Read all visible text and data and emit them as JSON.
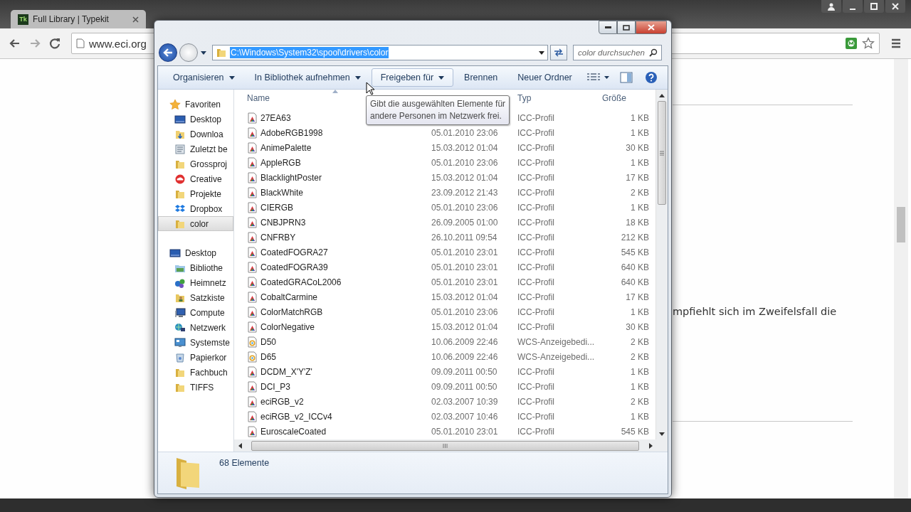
{
  "browser": {
    "tabs": [
      {
        "label": "Full Library | Typekit",
        "favicon": "Tk",
        "selected": false
      }
    ],
    "address": "www.eci.org",
    "page_text": "mpfiehlt sich im Zweifelsfall die"
  },
  "explorer": {
    "address": {
      "path": "C:\\Windows\\System32\\spool\\drivers\\color",
      "selected": true
    },
    "search": {
      "placeholder": "color durchsuchen"
    },
    "toolbar": [
      {
        "label": "Organisieren",
        "dropdown": true,
        "hover": false
      },
      {
        "label": "In Bibliothek aufnehmen",
        "dropdown": true,
        "hover": false
      },
      {
        "label": "Freigeben für",
        "dropdown": true,
        "hover": true
      },
      {
        "label": "Brennen",
        "dropdown": false,
        "hover": false
      },
      {
        "label": "Neuer Ordner",
        "dropdown": false,
        "hover": false
      }
    ],
    "tooltip": [
      "Gibt die ausgewählten Elemente für",
      "andere Personen im Netzwerk frei."
    ],
    "sidebar": [
      {
        "label": "Favoriten",
        "kind": "star",
        "selected": false,
        "children": [
          {
            "label": "Desktop",
            "kind": "desktop",
            "selected": false
          },
          {
            "label": "Downloa",
            "kind": "download",
            "selected": false
          },
          {
            "label": "Zuletzt be",
            "kind": "recent",
            "selected": false
          },
          {
            "label": "Grossproj",
            "kind": "folder",
            "selected": false
          },
          {
            "label": "Creative",
            "kind": "cloud",
            "selected": false
          },
          {
            "label": "Projekte",
            "kind": "folder",
            "selected": false
          },
          {
            "label": "Dropbox",
            "kind": "dropbox",
            "selected": false
          },
          {
            "label": "color",
            "kind": "folder",
            "selected": true
          }
        ]
      },
      {
        "label": "Desktop",
        "kind": "desktop",
        "selected": false,
        "children": [
          {
            "label": "Bibliothe",
            "kind": "library",
            "selected": false
          },
          {
            "label": "Heimnetz",
            "kind": "homegroup",
            "selected": false
          },
          {
            "label": "Satzkiste",
            "kind": "userfolder",
            "selected": false
          },
          {
            "label": "Compute",
            "kind": "computer",
            "selected": false
          },
          {
            "label": "Netzwerk",
            "kind": "network",
            "selected": false
          },
          {
            "label": "Systemste",
            "kind": "control",
            "selected": false
          },
          {
            "label": "Papierkor",
            "kind": "bin",
            "selected": false
          },
          {
            "label": "Fachbuch",
            "kind": "folder",
            "selected": false
          },
          {
            "label": "TIFFS",
            "kind": "folder",
            "selected": false
          }
        ]
      }
    ],
    "column_headers": {
      "name": "Name",
      "type": "Typ",
      "size": "Größe"
    },
    "rows": [
      {
        "kind": "icc",
        "name": "27EA63",
        "type": "ICC-Profil",
        "size": "1 KB"
      },
      {
        "kind": "icc",
        "name": "AdobeRGB1998",
        "date": "05.01.2010 23:06",
        "type": "ICC-Profil",
        "size": "1 KB"
      },
      {
        "kind": "icc",
        "name": "AnimePalette",
        "date": "15.03.2012 01:04",
        "type": "ICC-Profil",
        "size": "30 KB"
      },
      {
        "kind": "icc",
        "name": "AppleRGB",
        "date": "05.01.2010 23:06",
        "type": "ICC-Profil",
        "size": "1 KB"
      },
      {
        "kind": "icc",
        "name": "BlacklightPoster",
        "date": "15.03.2012 01:04",
        "type": "ICC-Profil",
        "size": "17 KB"
      },
      {
        "kind": "icc",
        "name": "BlackWhite",
        "date": "23.09.2012 21:43",
        "type": "ICC-Profil",
        "size": "2 KB"
      },
      {
        "kind": "icc",
        "name": "CIERGB",
        "date": "05.01.2010 23:06",
        "type": "ICC-Profil",
        "size": "1 KB"
      },
      {
        "kind": "icc",
        "name": "CNBJPRN3",
        "date": "26.09.2005 01:00",
        "type": "ICC-Profil",
        "size": "18 KB"
      },
      {
        "kind": "icc",
        "name": "CNFRBY",
        "date": "26.10.2011 09:54",
        "type": "ICC-Profil",
        "size": "212 KB"
      },
      {
        "kind": "icc",
        "name": "CoatedFOGRA27",
        "date": "05.01.2010 23:01",
        "type": "ICC-Profil",
        "size": "545 KB"
      },
      {
        "kind": "icc",
        "name": "CoatedFOGRA39",
        "date": "05.01.2010 23:01",
        "type": "ICC-Profil",
        "size": "640 KB"
      },
      {
        "kind": "icc",
        "name": "CoatedGRACoL2006",
        "date": "05.01.2010 23:01",
        "type": "ICC-Profil",
        "size": "640 KB"
      },
      {
        "kind": "icc",
        "name": "CobaltCarmine",
        "date": "15.03.2012 01:04",
        "type": "ICC-Profil",
        "size": "17 KB"
      },
      {
        "kind": "icc",
        "name": "ColorMatchRGB",
        "date": "05.01.2010 23:06",
        "type": "ICC-Profil",
        "size": "1 KB"
      },
      {
        "kind": "icc",
        "name": "ColorNegative",
        "date": "15.03.2012 01:04",
        "type": "ICC-Profil",
        "size": "30 KB"
      },
      {
        "kind": "wcs",
        "name": "D50",
        "date": "10.06.2009 22:46",
        "type": "WCS-Anzeigebedi...",
        "size": "2 KB"
      },
      {
        "kind": "wcs",
        "name": "D65",
        "date": "10.06.2009 22:46",
        "type": "WCS-Anzeigebedi...",
        "size": "2 KB"
      },
      {
        "kind": "icc",
        "name": "DCDM_X'Y'Z'",
        "date": "09.09.2011 00:50",
        "type": "ICC-Profil",
        "size": "1 KB"
      },
      {
        "kind": "icc",
        "name": "DCI_P3",
        "date": "09.09.2011 00:50",
        "type": "ICC-Profil",
        "size": "1 KB"
      },
      {
        "kind": "icc",
        "name": "eciRGB_v2",
        "date": "02.03.2007 10:39",
        "type": "ICC-Profil",
        "size": "2 KB"
      },
      {
        "kind": "icc",
        "name": "eciRGB_v2_ICCv4",
        "date": "02.03.2007 10:46",
        "type": "ICC-Profil",
        "size": "1 KB"
      },
      {
        "kind": "icc",
        "name": "EuroscaleCoated",
        "date": "05.01.2010 23:01",
        "type": "ICC-Profil",
        "size": "545 KB"
      }
    ],
    "status": "68 Elemente"
  }
}
